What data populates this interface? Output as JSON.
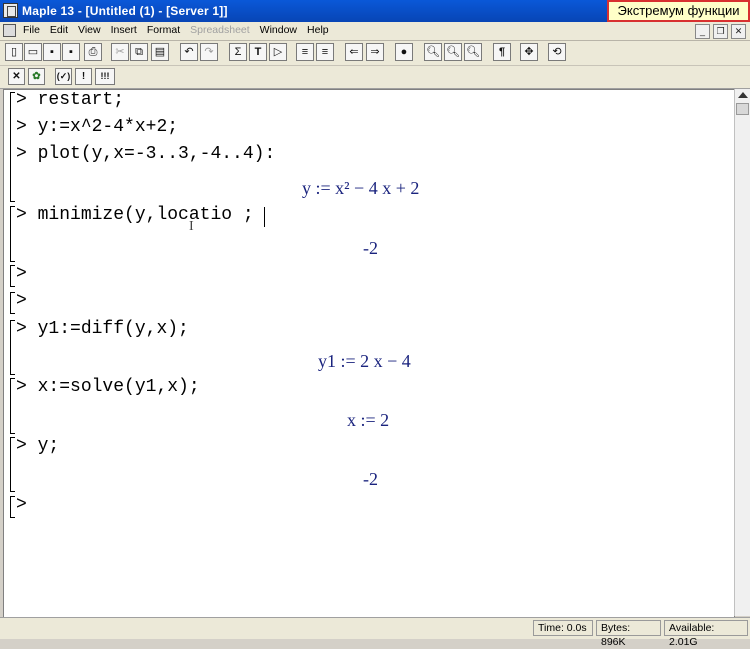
{
  "window": {
    "title": "Maple 13 - [Untitled (1) - [Server 1]]",
    "overlay_caption": "Экстремум функции"
  },
  "menu": {
    "items": [
      "File",
      "Edit",
      "View",
      "Insert",
      "Format",
      "Spreadsheet",
      "Window",
      "Help"
    ],
    "disabled_item": "Spreadsheet"
  },
  "toolbar": {
    "sigma": "Σ",
    "text_mode": "T",
    "pilcrow": "¶"
  },
  "toolbar2": {
    "check": "✓",
    "bang": "!",
    "triple_bang": "!!!"
  },
  "worksheet": {
    "prompt": ">",
    "groups": [
      {
        "inputs": [
          "restart;",
          "y:=x^2-4*x+2;",
          "plot(y,x=-3..3,-4..4):"
        ],
        "output": "y := x² − 4 x + 2"
      },
      {
        "inputs": [
          "minimize(y,locatio ;"
        ],
        "output": "-2"
      },
      {
        "inputs": [
          ""
        ]
      },
      {
        "inputs": [
          ""
        ]
      },
      {
        "inputs": [
          "y1:=diff(y,x);"
        ],
        "output": "y1 := 2 x − 4"
      },
      {
        "inputs": [
          "x:=solve(y1,x);"
        ],
        "output": "x := 2"
      },
      {
        "inputs": [
          "y;"
        ],
        "output": "-2"
      },
      {
        "inputs": [
          ""
        ]
      }
    ]
  },
  "status": {
    "time": "Time:  0.0s",
    "bytes": "Bytes:  896K",
    "available": "Available: 2.01G"
  }
}
